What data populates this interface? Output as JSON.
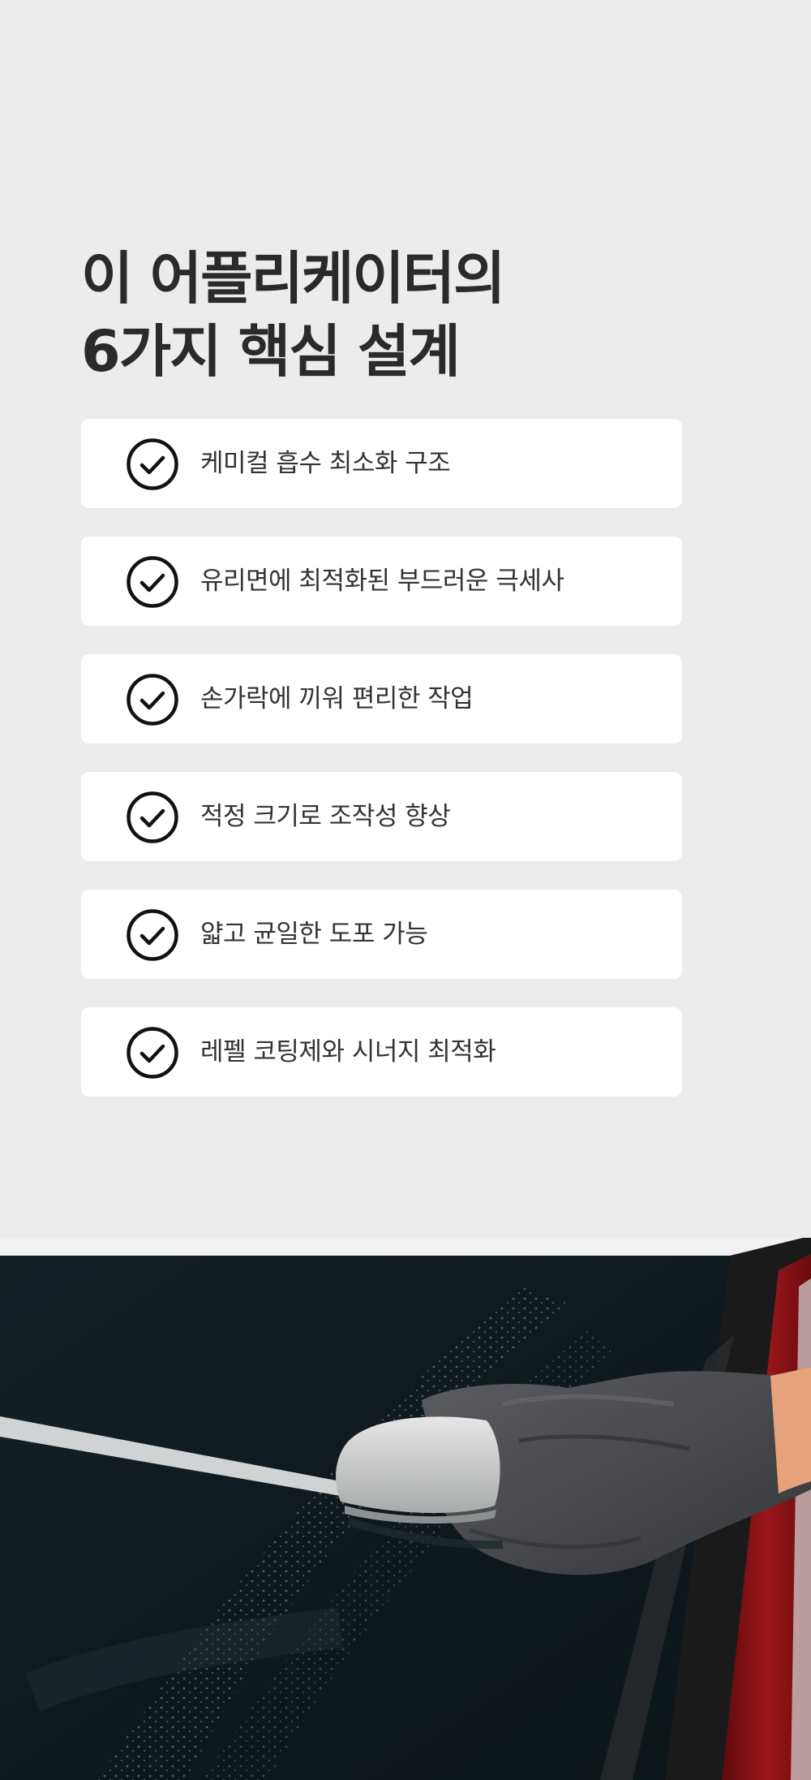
{
  "heading": {
    "line1": "이 어플리케이터의",
    "line2": "6가지 핵심 설계"
  },
  "features": [
    {
      "label": "케미컬 흡수 최소화 구조",
      "icon": "check-circle-icon"
    },
    {
      "label": "유리면에 최적화된 부드러운 극세사",
      "icon": "check-circle-icon"
    },
    {
      "label": "손가락에 끼워 편리한 작업",
      "icon": "check-circle-icon"
    },
    {
      "label": "적정 크기로 조작성 향상",
      "icon": "check-circle-icon"
    },
    {
      "label": "얇고 균일한 도포 가능",
      "icon": "check-circle-icon"
    },
    {
      "label": "레펠 코팅제와 시너지 최적화",
      "icon": "check-circle-icon"
    }
  ],
  "colors": {
    "background": "#ececec",
    "card": "#ffffff",
    "text": "#2b2b2b",
    "car_red": "#8e1418",
    "glove": "#4a4b4d"
  }
}
